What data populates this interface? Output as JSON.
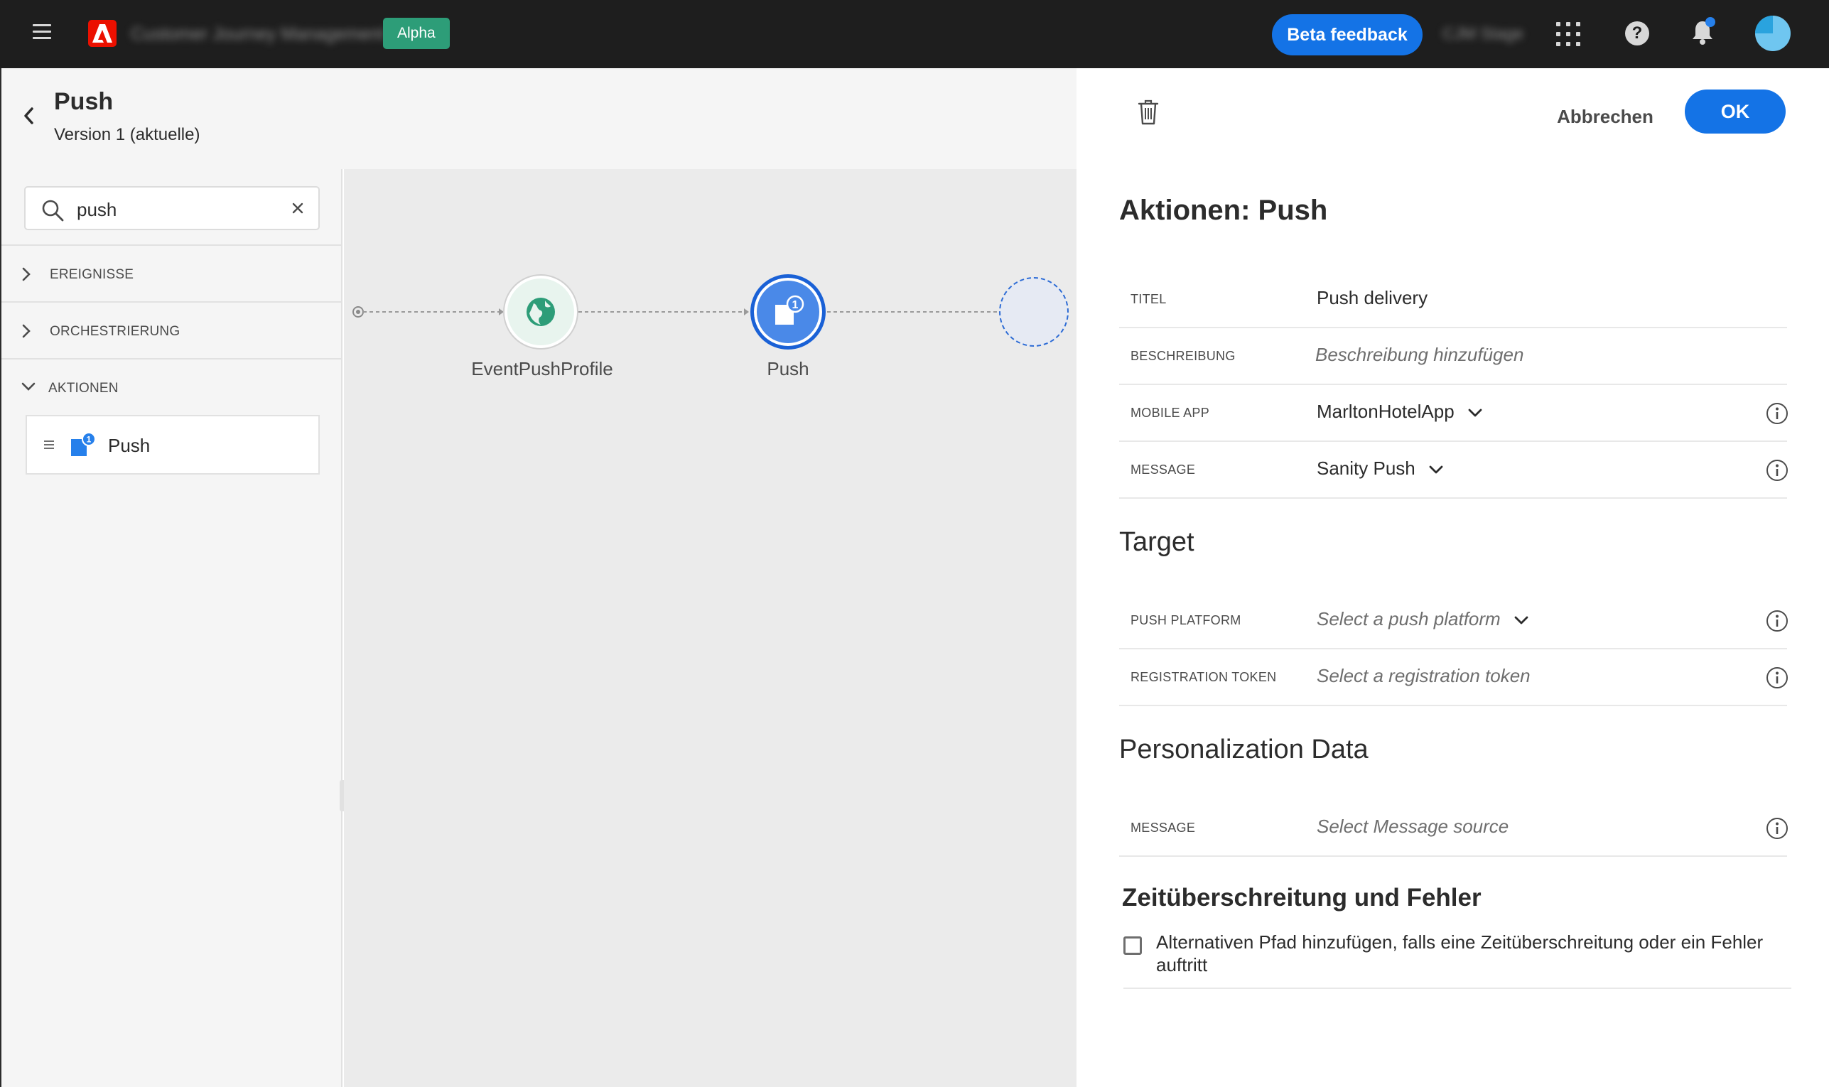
{
  "topbar": {
    "app_name": "Customer Journey Management",
    "environment_badge": "Alpha",
    "beta_feedback_label": "Beta feedback",
    "org_name": "CJM Stage"
  },
  "journey": {
    "title": "Push",
    "version": "Version 1 (aktuelle)"
  },
  "sidebar": {
    "search_value": "push",
    "sections": [
      {
        "label": "EREIGNISSE",
        "expanded": false
      },
      {
        "label": "ORCHESTRIERUNG",
        "expanded": false
      },
      {
        "label": "AKTIONEN",
        "expanded": true
      }
    ],
    "action_items": [
      {
        "label": "Push",
        "icon": "push-notification-icon",
        "badge": "1"
      }
    ]
  },
  "canvas": {
    "nodes": [
      {
        "label": "EventPushProfile",
        "icon": "globe-icon"
      },
      {
        "label": "Push",
        "icon": "push-notification-icon",
        "badge": "1"
      },
      {
        "label": "",
        "icon": "empty-drop-target"
      }
    ]
  },
  "panel": {
    "cancel_label": "Abbrechen",
    "ok_label": "OK",
    "title": "Aktionen: Push",
    "fields": [
      {
        "label": "TITEL",
        "value": "Push delivery"
      },
      {
        "label": "BESCHREIBUNG",
        "placeholder": "Beschreibung hinzufügen"
      },
      {
        "label": "MOBILE APP",
        "value": "MarltonHotelApp"
      },
      {
        "label": "MESSAGE",
        "value": "Sanity Push"
      }
    ],
    "target": {
      "heading": "Target",
      "fields": [
        {
          "label": "PUSH PLATFORM",
          "placeholder": "Select a push platform"
        },
        {
          "label": "REGISTRATION TOKEN",
          "placeholder": "Select a registration token"
        }
      ]
    },
    "personalization": {
      "heading": "Personalization Data",
      "fields": [
        {
          "label": "MESSAGE",
          "placeholder": "Select Message source"
        }
      ]
    },
    "timeout": {
      "heading": "Zeitüberschreitung und Fehler",
      "checkbox_label": "Alternativen Pfad hinzufügen, falls eine Zeitüberschreitung oder ein Fehler auftritt",
      "checked": false
    }
  },
  "colors": {
    "topbar_bg": "#1e1e1e",
    "accent_blue": "#1473e6",
    "badge_green": "#2d9d78",
    "adobe_red": "#eb1000",
    "canvas_bg": "#ebebeb"
  }
}
